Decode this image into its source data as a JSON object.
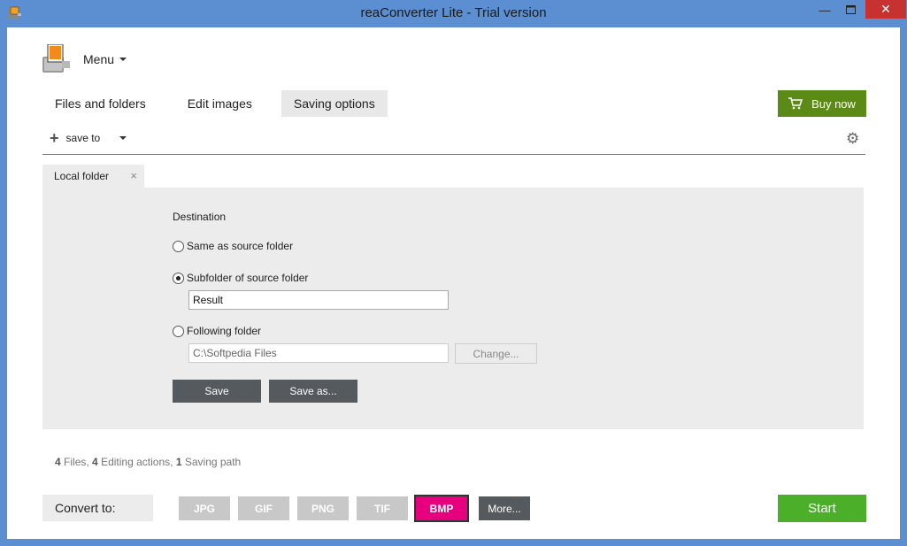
{
  "window": {
    "title": "reaConverter Lite - Trial version",
    "min_icon": "minimize-icon",
    "max_icon": "maximize-icon",
    "close_icon": "close-icon"
  },
  "menu": {
    "label": "Menu",
    "icon": "app-logo-icon"
  },
  "tabs": [
    {
      "label": "Files and folders",
      "active": false
    },
    {
      "label": "Edit images",
      "active": false
    },
    {
      "label": "Saving options",
      "active": true
    }
  ],
  "buy_button": {
    "label": "Buy now",
    "icon": "cart-icon",
    "color": "#5c8a16"
  },
  "saveto": {
    "label": "save to",
    "icon": "plus-icon"
  },
  "settings_icon": "gear-icon",
  "panel_tab": {
    "label": "Local folder",
    "close": "×"
  },
  "destination": {
    "heading": "Destination",
    "option_same": "Same as source folder",
    "option_subfolder": "Subfolder of source folder",
    "subfolder_value": "Result",
    "option_following": "Following folder",
    "following_value": "C:\\Softpedia Files",
    "change_label": "Change...",
    "selected": "subfolder"
  },
  "buttons": {
    "save": "Save",
    "save_as": "Save as..."
  },
  "status": {
    "files_count": "4",
    "files_label": "Files,",
    "edit_count": "4",
    "edit_label": "Editing actions,",
    "path_count": "1",
    "path_label": "Saving path"
  },
  "convert": {
    "label": "Convert to:",
    "formats": [
      "JPG",
      "GIF",
      "PNG",
      "TIF",
      "BMP"
    ],
    "selected": "BMP",
    "more": "More...",
    "active_color": "#e6007e"
  },
  "start_button": {
    "label": "Start",
    "color": "#4caf2a"
  }
}
